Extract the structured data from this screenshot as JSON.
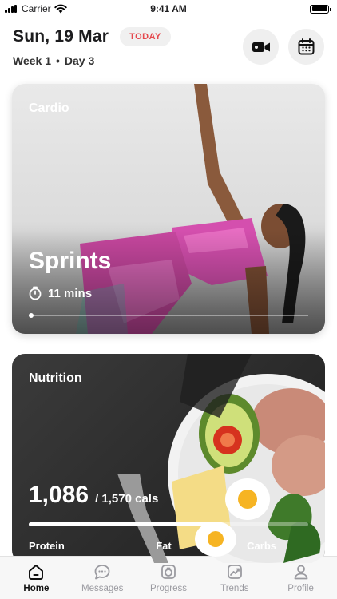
{
  "status_bar": {
    "carrier": "Carrier",
    "time": "9:41 AM"
  },
  "header": {
    "date": "Sun, 19 Mar",
    "badge": "TODAY",
    "week": "Week 1",
    "separator": "•",
    "day": "Day 3",
    "actions": [
      {
        "icon": "video-camera-icon"
      },
      {
        "icon": "calendar-icon"
      }
    ]
  },
  "cardio": {
    "label": "Cardio",
    "title": "Sprints",
    "duration": "11 mins",
    "progress": 0.0
  },
  "nutrition": {
    "label": "Nutrition",
    "calories": "1,086",
    "calories_goal": "/ 1,570 cals",
    "progress": 0.69,
    "macros": [
      "Protein",
      "Fat",
      "Carbs"
    ]
  },
  "tabs": [
    {
      "label": "Home",
      "icon": "home-icon",
      "active": true
    },
    {
      "label": "Messages",
      "icon": "chat-bubble-icon",
      "active": false
    },
    {
      "label": "Progress",
      "icon": "progress-icon",
      "active": false
    },
    {
      "label": "Trends",
      "icon": "trends-icon",
      "active": false
    },
    {
      "label": "Profile",
      "icon": "profile-icon",
      "active": false
    }
  ],
  "colors": {
    "accent": "#e5484d",
    "card_dark": "#2a2a2a",
    "inactive_tab": "#9a9aa0"
  }
}
